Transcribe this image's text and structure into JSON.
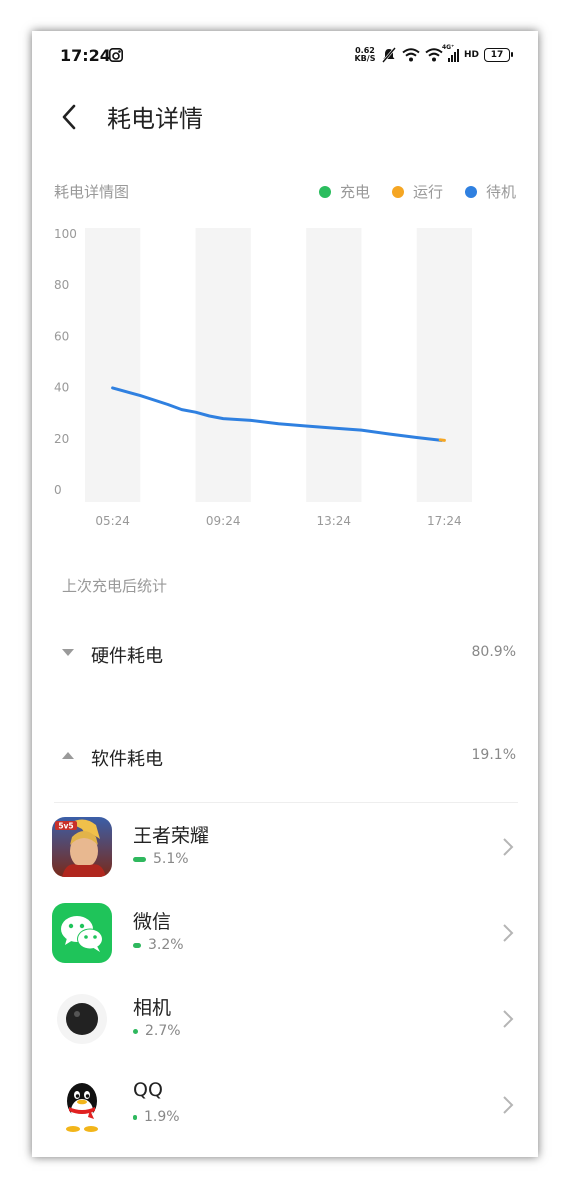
{
  "status_bar": {
    "time": "17:24",
    "net_speed_value": "0.62",
    "net_speed_unit": "KB/S",
    "signal_label": "4G⁺",
    "hd_label": "HD",
    "battery_level": "17",
    "icons": [
      "notification-icon",
      "mute-icon",
      "wifi-icon",
      "wifi-icon",
      "signal-icon",
      "battery-icon"
    ]
  },
  "header": {
    "title": "耗电详情"
  },
  "chart_data": {
    "type": "line",
    "title": "耗电详情图",
    "legend": [
      {
        "name": "充电",
        "color": "#2bbd5e"
      },
      {
        "name": "运行",
        "color": "#f5a623"
      },
      {
        "name": "待机",
        "color": "#2f80e0"
      }
    ],
    "y_ticks": [
      "100",
      "80",
      "60",
      "40",
      "20",
      "0"
    ],
    "x_ticks": [
      "05:24",
      "09:24",
      "13:24",
      "17:24"
    ],
    "ylim": [
      0,
      100
    ],
    "xlim": [
      0,
      13
    ],
    "bands": [
      [
        0,
        2
      ],
      [
        4,
        6
      ],
      [
        8,
        10
      ],
      [
        12,
        14
      ]
    ],
    "series": [
      {
        "name": "待机",
        "color": "#2f80e0",
        "points": [
          [
            1,
            39.5
          ],
          [
            2,
            36.5
          ],
          [
            3,
            33
          ],
          [
            3.5,
            31
          ],
          [
            4,
            30
          ],
          [
            4.5,
            28.5
          ],
          [
            5,
            27.5
          ],
          [
            6,
            26.8
          ],
          [
            7,
            25.5
          ],
          [
            8,
            24.6
          ],
          [
            9,
            23.8
          ],
          [
            10,
            23
          ],
          [
            11,
            21.5
          ],
          [
            12,
            20.1
          ],
          [
            12.9,
            19
          ]
        ]
      },
      {
        "name": "运行",
        "color": "#f5a623",
        "points": [
          [
            12.85,
            19.2
          ],
          [
            13,
            19
          ]
        ]
      }
    ]
  },
  "stats_title": "上次充电后统计",
  "sections": [
    {
      "label": "硬件耗电",
      "value": "80.9%",
      "expanded": false
    },
    {
      "label": "软件耗电",
      "value": "19.1%",
      "expanded": true
    }
  ],
  "apps": [
    {
      "name": "王者荣耀",
      "percent": "5.1%",
      "share": 5.1,
      "icon": "honor-of-kings-icon"
    },
    {
      "name": "微信",
      "percent": "3.2%",
      "share": 3.2,
      "icon": "wechat-icon"
    },
    {
      "name": "相机",
      "percent": "2.7%",
      "share": 2.7,
      "icon": "camera-icon"
    },
    {
      "name": "QQ",
      "percent": "1.9%",
      "share": 1.9,
      "icon": "qq-icon"
    }
  ],
  "colors": {
    "accent_green": "#2fb85e",
    "chart_band": "#f4f4f4",
    "text_gray": "#999999"
  }
}
